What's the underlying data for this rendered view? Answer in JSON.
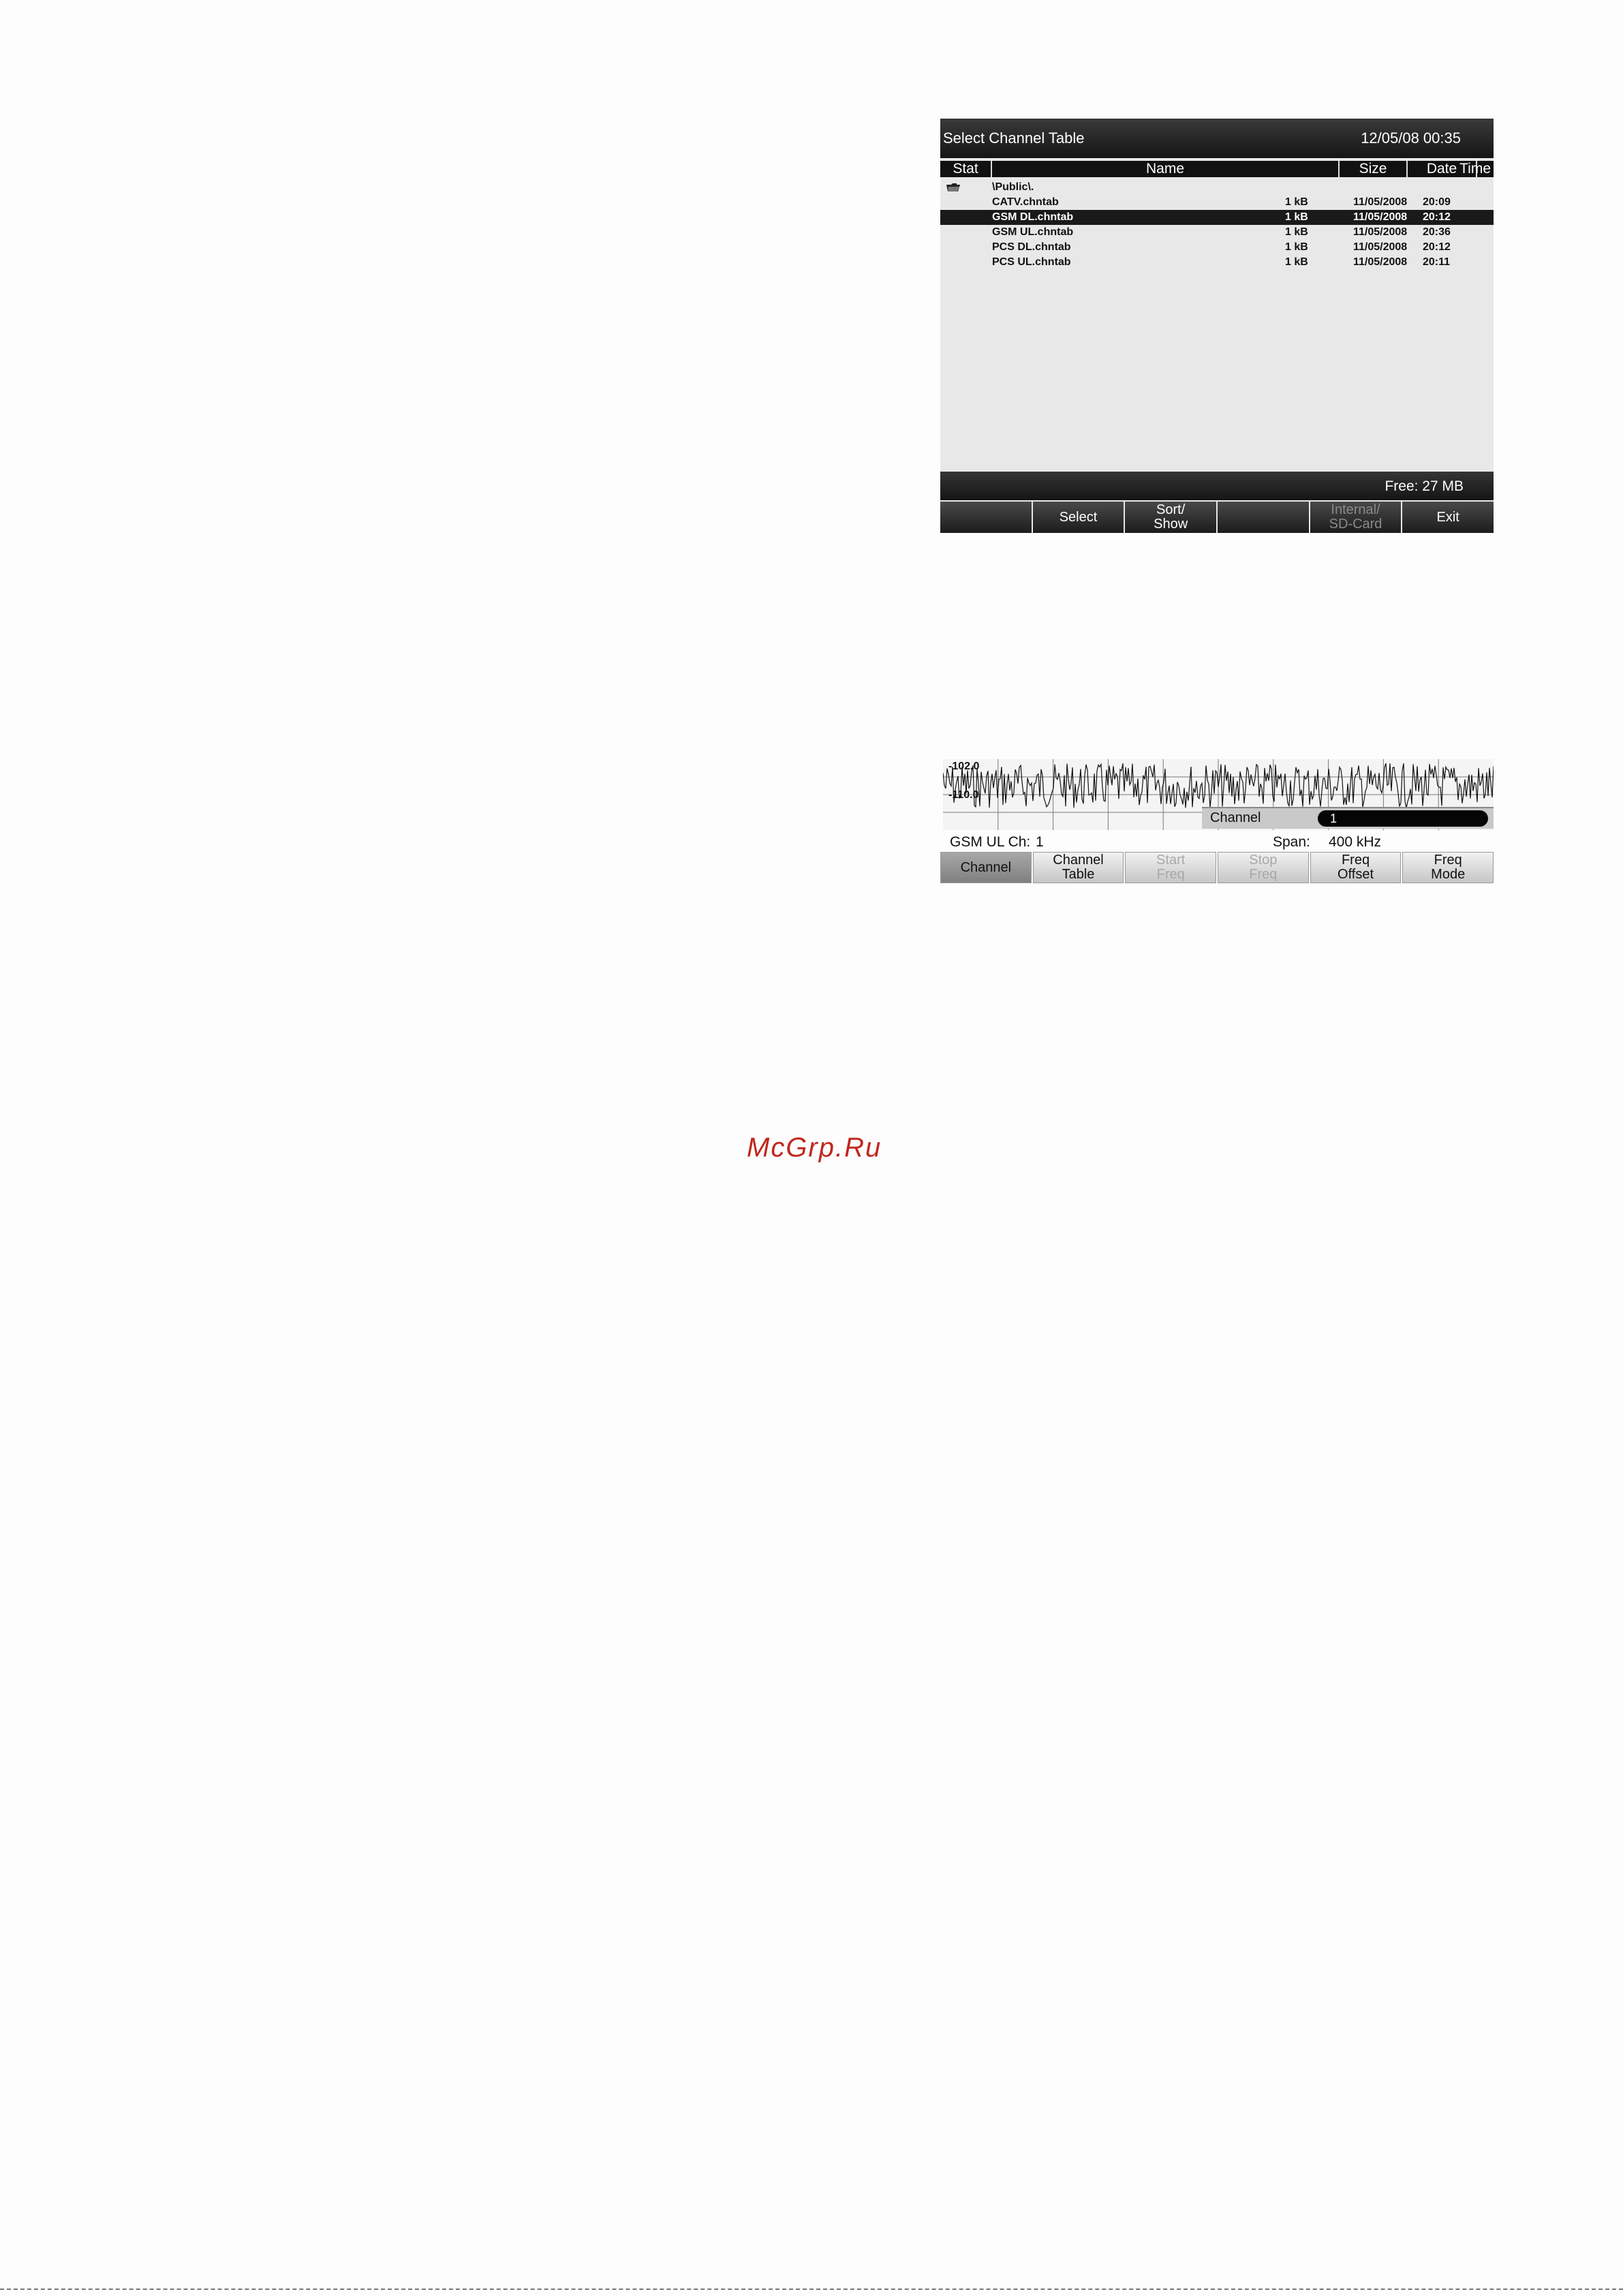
{
  "dialog": {
    "title": "Select Channel Table",
    "datetime": "12/05/08 00:35",
    "columns": {
      "stat": "Stat",
      "name": "Name",
      "size": "Size",
      "date": "Date",
      "time": "Time"
    },
    "folder": "\\Public\\.",
    "files": [
      {
        "name": "CATV.chntab",
        "size": "1 kB",
        "date": "11/05/2008",
        "time": "20:09",
        "selected": false
      },
      {
        "name": "GSM DL.chntab",
        "size": "1 kB",
        "date": "11/05/2008",
        "time": "20:12",
        "selected": true
      },
      {
        "name": "GSM UL.chntab",
        "size": "1 kB",
        "date": "11/05/2008",
        "time": "20:36",
        "selected": false
      },
      {
        "name": "PCS DL.chntab",
        "size": "1 kB",
        "date": "11/05/2008",
        "time": "20:12",
        "selected": false
      },
      {
        "name": "PCS UL.chntab",
        "size": "1 kB",
        "date": "11/05/2008",
        "time": "20:11",
        "selected": false
      }
    ],
    "free": "Free: 27 MB",
    "softkeys": {
      "k1": "",
      "k2": "Select",
      "k3a": "Sort/",
      "k3b": "Show",
      "k4": "",
      "k5a": "Internal/",
      "k5b": "SD-Card",
      "k6": "Exit"
    }
  },
  "channel_view": {
    "level_top": "-102.0",
    "level_bottom": "-110.0",
    "input_label": "Channel",
    "input_value": "1",
    "info_label": "GSM UL Ch:",
    "info_value": "1",
    "span_label": "Span:",
    "span_value": "400 kHz",
    "softkeys": {
      "k1": "Channel",
      "k2a": "Channel",
      "k2b": "Table",
      "k3a": "Start",
      "k3b": "Freq",
      "k4a": "Stop",
      "k4b": "Freq",
      "k5a": "Freq",
      "k5b": "Offset",
      "k6a": "Freq",
      "k6b": "Mode"
    }
  },
  "watermark": "McGrp.Ru"
}
